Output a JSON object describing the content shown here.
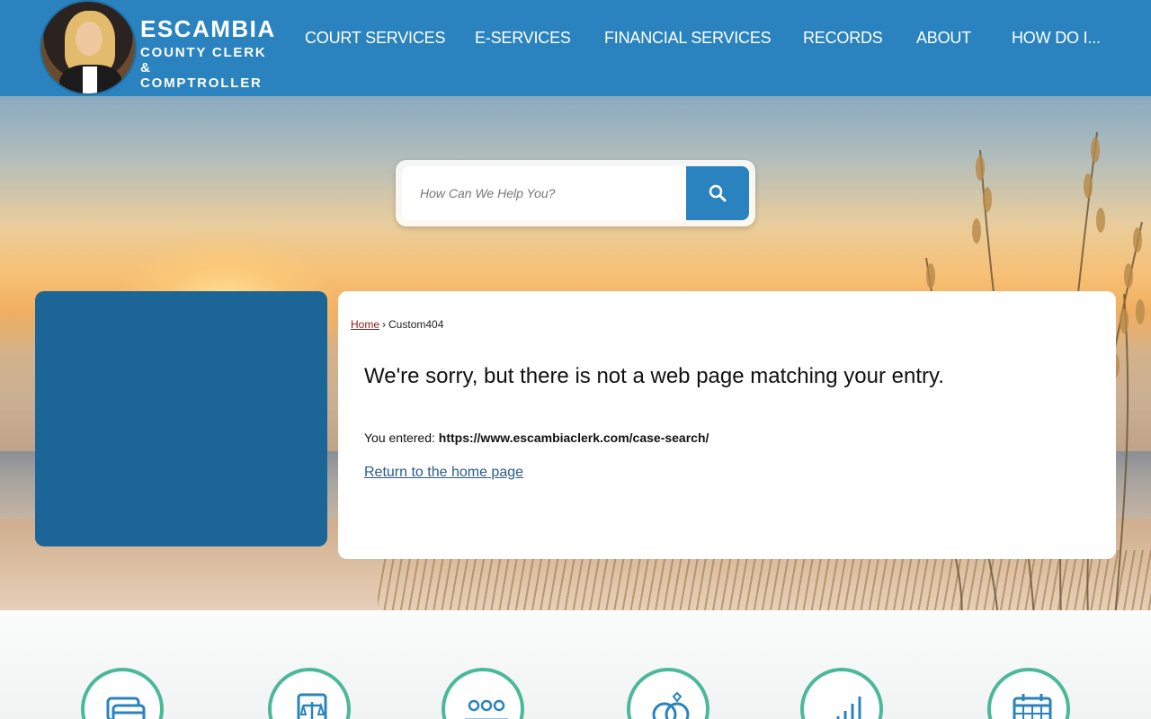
{
  "header": {
    "logo_title": "ESCAMBIA",
    "logo_sub1": "COUNTY CLERK",
    "logo_sub2": "& COMPTROLLER",
    "nav": [
      "COURT SERVICES",
      "E-SERVICES",
      "FINANCIAL SERVICES",
      "RECORDS",
      "ABOUT",
      "HOW DO I..."
    ]
  },
  "search": {
    "placeholder": "How Can We Help You?",
    "button_icon": "search-icon"
  },
  "breadcrumb": {
    "home": "Home",
    "separator": "›",
    "current": "Custom404"
  },
  "content": {
    "title": "We're sorry, but there is not a web page matching your entry.",
    "entered_label": "You entered:",
    "entered_url": "https://www.escambiaclerk.com/case-search/",
    "return_link": "Return to the home page"
  },
  "quick_links": {
    "icons": [
      "payment-cards-icon",
      "legal-scales-icon",
      "people-meeting-icon",
      "wedding-rings-icon",
      "bar-chart-icon",
      "calendar-icon"
    ]
  },
  "colors": {
    "header_blue": "#2a83be",
    "side_box_blue": "#1b6597",
    "accent_teal": "#4bb89a",
    "breadcrumb_link": "#8b1a1a"
  }
}
